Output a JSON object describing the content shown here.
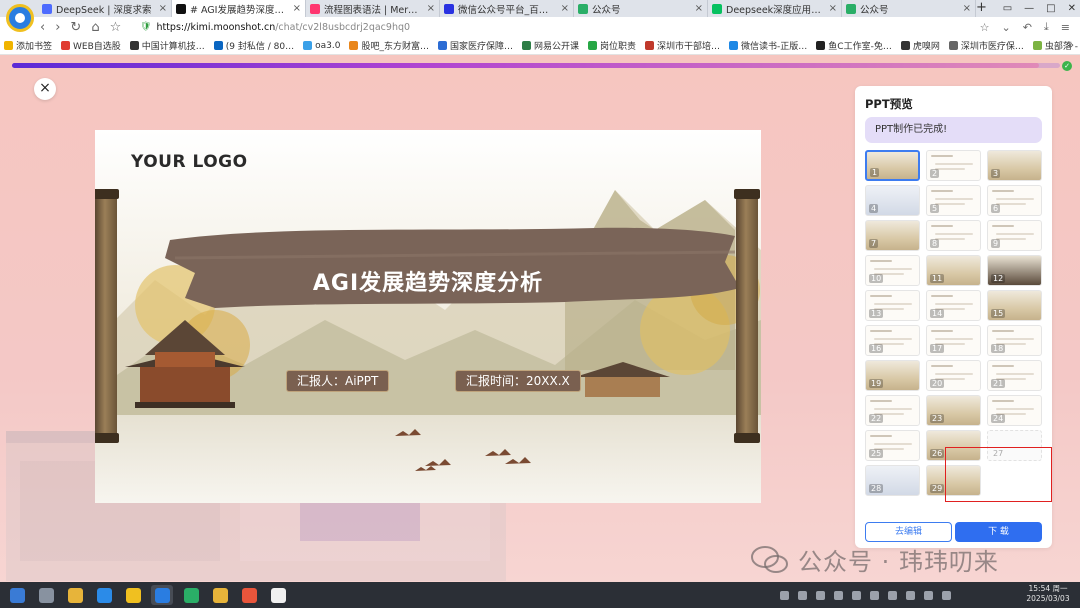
{
  "browser": {
    "tabs": [
      {
        "label": "DeepSeek | 深度求索",
        "icon_color": "#4d6bfe",
        "active": false
      },
      {
        "label": "# AGI发展趋势深度分析 #",
        "icon_color": "#111111",
        "active": true
      },
      {
        "label": "流程图表语法 | Mermaid 中",
        "icon_color": "#ff3670",
        "active": false
      },
      {
        "label": "微信公众号平台_百度搜索",
        "icon_color": "#2932e1",
        "active": false
      },
      {
        "label": "公众号",
        "icon_color": "#2aae67",
        "active": false
      },
      {
        "label": "Deepseek深度应用指南--",
        "icon_color": "#07c160",
        "active": false
      },
      {
        "label": "公众号",
        "icon_color": "#2aae67",
        "active": false
      }
    ],
    "new_tab": "+",
    "url_host": "https://kimi.moonshot.cn",
    "url_path": "/chat/cv2l8usbcdrj2qac9hq0",
    "bookmarks": [
      {
        "label": "添加书签",
        "color": "#f0b400"
      },
      {
        "label": "WEB自选股",
        "color": "#e03c31"
      },
      {
        "label": "中国计算机技…",
        "color": "#333333"
      },
      {
        "label": "(9 封私信 / 80…",
        "color": "#0a66c2"
      },
      {
        "label": "oa3.0",
        "color": "#3aa0e8"
      },
      {
        "label": "股吧_东方财富…",
        "color": "#e9861b"
      },
      {
        "label": "国家医疗保障…",
        "color": "#2b6cd4"
      },
      {
        "label": "网易公开课",
        "color": "#2d7d46"
      },
      {
        "label": "岗位职责",
        "color": "#27a745"
      },
      {
        "label": "深圳市干部培…",
        "color": "#c0392b"
      },
      {
        "label": "微信读书-正版…",
        "color": "#1e88e5"
      },
      {
        "label": "鱼C工作室-免…",
        "color": "#222222"
      },
      {
        "label": "虎嗅网",
        "color": "#333333"
      },
      {
        "label": "深圳市医疗保…",
        "color": "#666666"
      },
      {
        "label": "虫部落 - 让搜…",
        "color": "#7cb342"
      }
    ]
  },
  "progress": {
    "fraction": 0.98
  },
  "close_label": "×",
  "slide": {
    "logo": "YOUR LOGO",
    "title": "AGI发展趋势深度分析",
    "reporter": "汇报人：AiPPT",
    "report_time": "汇报时间：20XX.X"
  },
  "panel": {
    "title": "PPT预览",
    "status": "PPT制作已完成!",
    "thumbnails": [
      {
        "n": "1",
        "style": "scenic",
        "selected": true
      },
      {
        "n": "2",
        "style": "plain"
      },
      {
        "n": "3",
        "style": "scenic"
      },
      {
        "n": "4",
        "style": "blue"
      },
      {
        "n": "5",
        "style": "plain"
      },
      {
        "n": "6",
        "style": "plain"
      },
      {
        "n": "7",
        "style": "scenic"
      },
      {
        "n": "8",
        "style": "plain"
      },
      {
        "n": "9",
        "style": "plain"
      },
      {
        "n": "10",
        "style": "plain"
      },
      {
        "n": "11",
        "style": "scenic"
      },
      {
        "n": "12",
        "style": "dark"
      },
      {
        "n": "13",
        "style": "plain"
      },
      {
        "n": "14",
        "style": "plain"
      },
      {
        "n": "15",
        "style": "scenic"
      },
      {
        "n": "16",
        "style": "plain"
      },
      {
        "n": "17",
        "style": "plain"
      },
      {
        "n": "18",
        "style": "plain"
      },
      {
        "n": "19",
        "style": "scenic"
      },
      {
        "n": "20",
        "style": "plain"
      },
      {
        "n": "21",
        "style": "plain"
      },
      {
        "n": "22",
        "style": "plain"
      },
      {
        "n": "23",
        "style": "scenic"
      },
      {
        "n": "24",
        "style": "plain"
      },
      {
        "n": "25",
        "style": "plain"
      },
      {
        "n": "26",
        "style": "scenic"
      },
      {
        "n": "27",
        "style": "empty"
      },
      {
        "n": "28",
        "style": "blue"
      },
      {
        "n": "29",
        "style": "scenic"
      }
    ],
    "edit_label": "去编辑",
    "download_label": "下 载"
  },
  "watermark": "公众号 · 玮玮叨来",
  "taskbar": {
    "apps": [
      {
        "name": "launcher",
        "color": "#3a7bd5"
      },
      {
        "name": "multitask",
        "color": "#8892a0"
      },
      {
        "name": "file-manager",
        "color": "#e7b43a"
      },
      {
        "name": "app-store",
        "color": "#2b8be8"
      },
      {
        "name": "browser-2",
        "color": "#f0c020"
      },
      {
        "name": "browser",
        "color": "#2a7de1"
      },
      {
        "name": "wechat",
        "color": "#2aae67"
      },
      {
        "name": "folder",
        "color": "#e7b43a"
      },
      {
        "name": "image-viewer",
        "color": "#e9553b"
      },
      {
        "name": "notes",
        "color": "#f0f0f0"
      }
    ],
    "time": "15:54 周一",
    "date": "2025/03/03"
  }
}
